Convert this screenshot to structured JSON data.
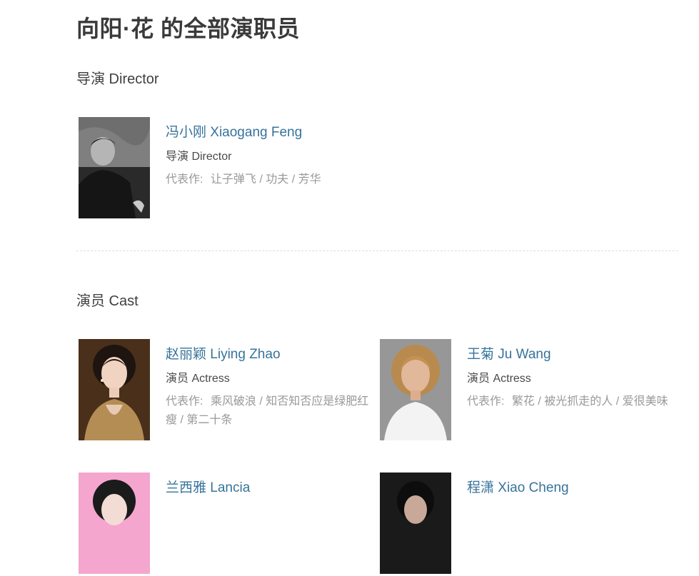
{
  "page": {
    "title": "向阳·花 的全部演职员"
  },
  "sections": {
    "director": {
      "title": "导演 Director"
    },
    "cast": {
      "title": "演员 Cast"
    }
  },
  "works_label": "代表作:",
  "people": [
    {
      "name": "冯小刚 Xiaogang Feng",
      "role": "导演 Director",
      "works": [
        "让子弹飞",
        "功夫",
        "芳华"
      ]
    },
    {
      "name": "赵丽颖 Liying Zhao",
      "role": "演员 Actress",
      "works": [
        "乘风破浪",
        "知否知否应是绿肥红瘦",
        "第二十条"
      ]
    },
    {
      "name": "王菊 Ju Wang",
      "role": "演员 Actress",
      "works": [
        "繁花",
        "被光抓走的人",
        "爱很美味"
      ]
    },
    {
      "name": "兰西雅 Lancia",
      "role": "",
      "works": []
    },
    {
      "name": "程潇 Xiao Cheng",
      "role": "",
      "works": []
    }
  ]
}
